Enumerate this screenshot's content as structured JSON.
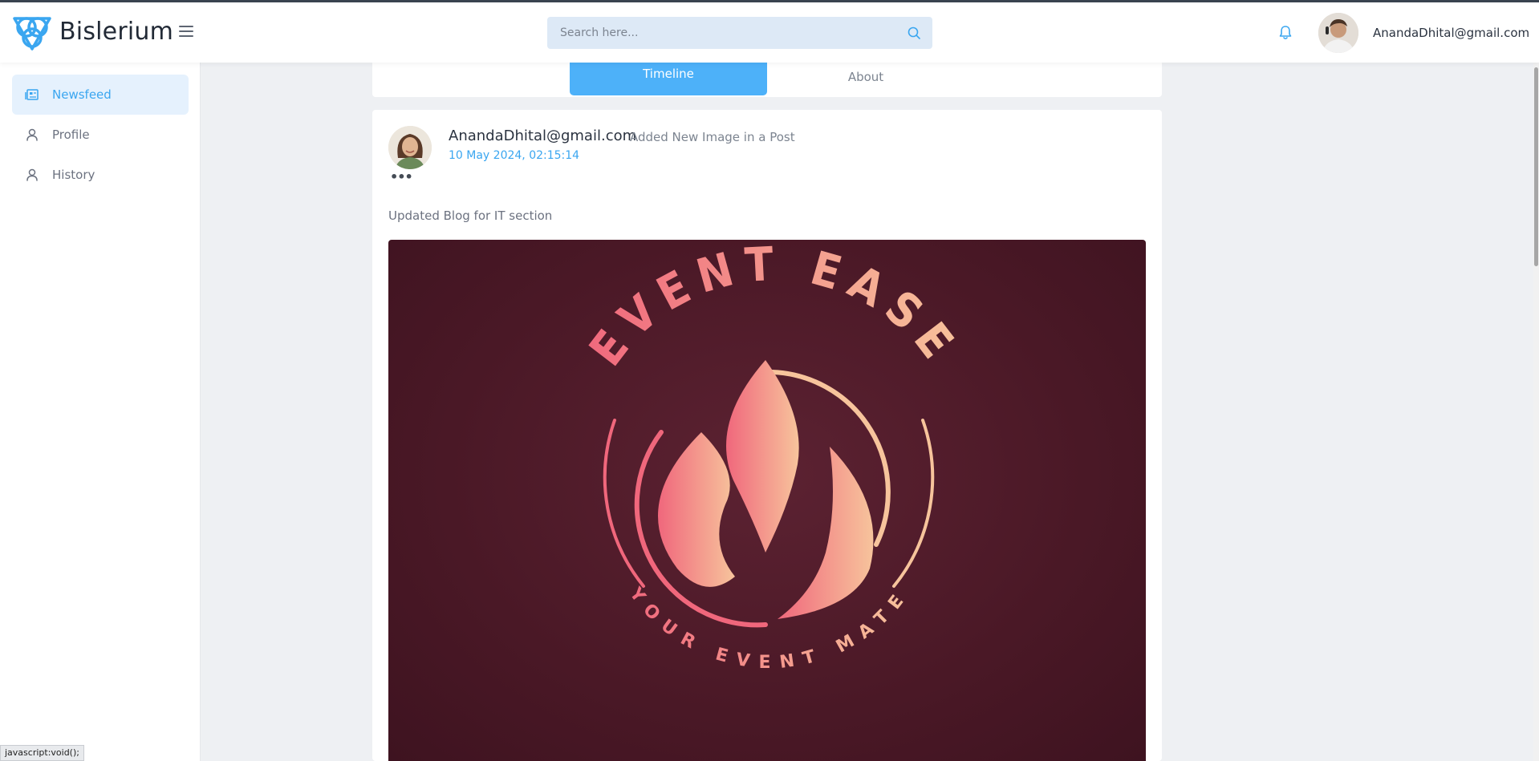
{
  "app": {
    "brand": "Bislerium"
  },
  "search": {
    "placeholder": "Search here..."
  },
  "header": {
    "user_email": "AnandaDhital@gmail.com"
  },
  "sidebar": {
    "items": [
      {
        "label": "Newsfeed",
        "icon": "newspaper-icon",
        "active": true
      },
      {
        "label": "Profile",
        "icon": "user-icon",
        "active": false
      },
      {
        "label": "History",
        "icon": "user-icon",
        "active": false
      }
    ]
  },
  "tabs": [
    {
      "label": "Timeline",
      "active": true
    },
    {
      "label": "About",
      "active": false
    }
  ],
  "post": {
    "author": "AnandaDhital@gmail.com",
    "action": "Added New Image in a Post",
    "date": "10 May 2024, 02:15:14",
    "more": "•••",
    "text": "Updated Blog for IT section",
    "image": {
      "logo_title": "EVENT EASE",
      "logo_tagline": "YOUR EVENT MATE"
    }
  },
  "status_bar": {
    "link": "javascript:void();"
  },
  "colors": {
    "accent": "#4db1f9",
    "accent_text": "#3aa6f0",
    "active_bg": "#e5f1fd",
    "image_bg": "#4a1826",
    "logo_pink": "#f0677c",
    "logo_peach": "#f7c49c"
  }
}
